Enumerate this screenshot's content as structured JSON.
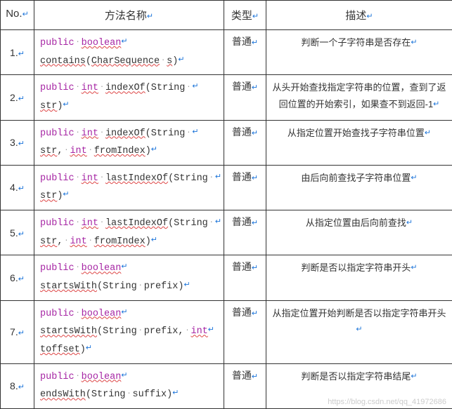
{
  "headers": {
    "no": "No.",
    "method": "方法名称",
    "type": "类型",
    "desc": "描述"
  },
  "glyphs": {
    "enter": "↵",
    "dot": "·"
  },
  "rows": [
    {
      "no": "1.",
      "method_html": "<span class='kw-public'>public</span><span class='dot'>·</span><span class='kw-type'>boolean</span><span class='enter'>↵</span><br><span class='kw-name'>contains</span>(<span class='kw-name'>CharSequence</span><span class='dot'>·</span><span class='kw-argname'>s</span>)<span class='enter'>↵</span>",
      "type": "普通",
      "desc": "判断一个子字符串是否存在"
    },
    {
      "no": "2.",
      "method_html": "<span class='kw-public'>public</span><span class='dot'>·</span><span class='kw-type'>int</span><span class='dot'>·</span><span class='kw-name'>indexOf</span>(String<span class='dot'>·</span><span class='enter'>↵</span><br><span class='kw-argname'>str</span>)<span class='enter'>↵</span>",
      "type": "普通",
      "desc": "从头开始查找指定字符串的位置，查到了返回位置的开始索引，如果查不到返回-1"
    },
    {
      "no": "3.",
      "method_html": "<span class='kw-public'>public</span><span class='dot'>·</span><span class='kw-type'>int</span><span class='dot'>·</span><span class='kw-name'>indexOf</span>(String<span class='dot'>·</span><span class='enter'>↵</span><br><span class='kw-argname'>str</span>,<span class='dot'>·</span><span class='kw-type'>int</span><span class='dot'>·</span><span class='kw-argname'>fromIndex</span>)<span class='enter'>↵</span>",
      "type": "普通",
      "desc": "从指定位置开始查找子字符串位置"
    },
    {
      "no": "4.",
      "method_html": "<span class='kw-public'>public</span><span class='dot'>·</span><span class='kw-type'>int</span><span class='dot'>·</span><span class='kw-name'>lastIndexOf</span>(String<span class='dot'>·</span><span class='enter'>↵</span><br><span class='kw-argname'>str</span>)<span class='enter'>↵</span>",
      "type": "普通",
      "desc": "由后向前查找子字符串位置"
    },
    {
      "no": "5.",
      "method_html": "<span class='kw-public'>public</span><span class='dot'>·</span><span class='kw-type'>int</span><span class='dot'>·</span><span class='kw-name'>lastIndexOf</span>(String<span class='dot'>·</span><span class='enter'>↵</span><br><span class='kw-argname'>str</span>,<span class='dot'>·</span><span class='kw-type'>int</span><span class='dot'>·</span><span class='kw-argname'>fromIndex</span>)<span class='enter'>↵</span>",
      "type": "普通",
      "desc": "从指定位置由后向前查找"
    },
    {
      "no": "6.",
      "method_html": "<span class='kw-public'>public</span><span class='dot'>·</span><span class='kw-type'>boolean</span><span class='enter'>↵</span><br><span class='kw-name'>startsWith</span>(String<span class='dot'>·</span>prefix)<span class='enter'>↵</span>",
      "type": "普通",
      "desc": "判断是否以指定字符串开头"
    },
    {
      "no": "7.",
      "method_html": "<span class='kw-public'>public</span><span class='dot'>·</span><span class='kw-type'>boolean</span><span class='enter'>↵</span><br><span class='kw-name'>startsWith</span>(String<span class='dot'>·</span>prefix,<span class='dot'>·</span><span class='kw-type'>int</span><span class='enter'>↵</span><br><span class='kw-argname'>toffset</span>)<span class='enter'>↵</span>",
      "type": "普通",
      "desc": "从指定位置开始判断是否以指定字符串开头"
    },
    {
      "no": "8.",
      "method_html": "<span class='kw-public'>public</span><span class='dot'>·</span><span class='kw-type'>boolean</span><span class='enter'>↵</span><br><span class='kw-name'>endsWith</span>(String<span class='dot'>·</span>suffix)<span class='enter'>↵</span>",
      "type": "普通",
      "desc": "判断是否以指定字符串结尾"
    }
  ],
  "watermark": "https://blog.csdn.net/qq_41972686"
}
